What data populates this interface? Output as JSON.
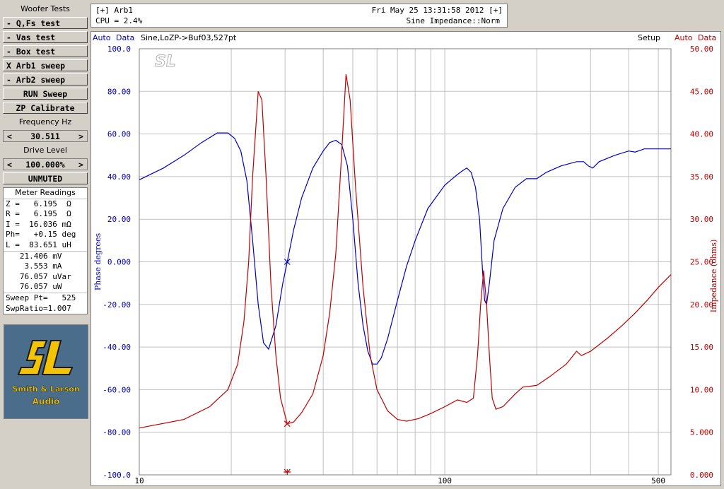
{
  "panel": {
    "title": "Woofer Tests",
    "buttons": {
      "qfs": "- Q,Fs test",
      "vas": "- Vas test",
      "box": "- Box test",
      "arb1": "X Arb1 sweep",
      "arb2": "- Arb2 sweep",
      "run": "RUN Sweep",
      "zp": "ZP Calibrate"
    },
    "freq_label": "Frequency Hz",
    "freq_value": "30.511",
    "drive_label": "Drive Level",
    "drive_value": "100.000%",
    "mute": "UNMUTED",
    "spin_left": "<",
    "spin_right": ">"
  },
  "meter": {
    "title": "Meter Readings",
    "lines": [
      "Z =   6.195  Ω",
      "R =   6.195  Ω",
      "I =  16.036 mΩ",
      "Ph=   +0.15 deg",
      "L =  83.651 uH",
      "   21.406 mV",
      "    3.553 mA",
      "   76.057 uVar",
      "   76.057 uW",
      "Sweep Pt=   525",
      "SwpRatio=1.007"
    ]
  },
  "logo": {
    "line1": "Smith & Larson",
    "line2": "Audio"
  },
  "header": {
    "window": "[+] Arb1",
    "datetime": "Fri May 25 13:31:58 2012 [+]",
    "cpu": "CPU = 2.4%",
    "mode": "Sine Impedance::Norm"
  },
  "graph": {
    "left_auto": "Auto",
    "left_data": "Data",
    "trace_info": "Sine,LoZP->Buf03,527pt",
    "setup": "Setup",
    "right_auto": "Auto",
    "right_data": "Data",
    "watermark": "SL"
  },
  "colors": {
    "phase": "#0000c0",
    "impedance": "#c00000",
    "grid": "#c0c0c0"
  },
  "chart_data": {
    "type": "line",
    "xscale": "log",
    "xlim": [
      10,
      550
    ],
    "x_ticks": [
      "10",
      "100",
      "500"
    ],
    "y_left": {
      "label": "Phase degrees",
      "range": [
        -100,
        100
      ],
      "ticks": [
        "100.0",
        "80.00",
        "60.00",
        "40.00",
        "20.00",
        "0.000",
        "-20.00",
        "-40.00",
        "-60.00",
        "-80.00",
        "-100.0"
      ]
    },
    "y_right": {
      "label": "Impedance (ohms)",
      "range": [
        0,
        50
      ],
      "ticks": [
        "50.00",
        "45.00",
        "40.00",
        "35.00",
        "30.00",
        "25.00",
        "20.00",
        "15.00",
        "10.00",
        "5.000",
        "0.000"
      ]
    },
    "cursor_x": 30.5,
    "series": [
      {
        "axis": "left",
        "color": "#0000c0",
        "points": [
          [
            10,
            38.5
          ],
          [
            12,
            44
          ],
          [
            14,
            50
          ],
          [
            16,
            56
          ],
          [
            18,
            60.5
          ],
          [
            19.5,
            60.5
          ],
          [
            20.5,
            58
          ],
          [
            21.5,
            52
          ],
          [
            22.5,
            38
          ],
          [
            23.5,
            10
          ],
          [
            24.5,
            -20
          ],
          [
            25.5,
            -38
          ],
          [
            26.5,
            -41
          ],
          [
            28,
            -30
          ],
          [
            29.5,
            -10
          ],
          [
            30.5,
            0
          ],
          [
            32,
            15
          ],
          [
            34,
            30
          ],
          [
            37,
            44
          ],
          [
            40,
            52
          ],
          [
            42,
            56
          ],
          [
            44,
            57
          ],
          [
            46,
            55
          ],
          [
            48,
            45
          ],
          [
            50,
            20
          ],
          [
            52,
            -10
          ],
          [
            54,
            -30
          ],
          [
            56,
            -42
          ],
          [
            58,
            -48
          ],
          [
            60,
            -48
          ],
          [
            62,
            -45
          ],
          [
            65,
            -36
          ],
          [
            70,
            -18
          ],
          [
            75,
            -2
          ],
          [
            80,
            10
          ],
          [
            88,
            25
          ],
          [
            100,
            36
          ],
          [
            110,
            41
          ],
          [
            115,
            43
          ],
          [
            118,
            44
          ],
          [
            122,
            42
          ],
          [
            126,
            35
          ],
          [
            130,
            20
          ],
          [
            133,
            -5
          ],
          [
            135,
            -18
          ],
          [
            137,
            -20
          ],
          [
            140,
            -10
          ],
          [
            145,
            10
          ],
          [
            155,
            25
          ],
          [
            170,
            35
          ],
          [
            185,
            39
          ],
          [
            200,
            39
          ],
          [
            215,
            42
          ],
          [
            240,
            45
          ],
          [
            270,
            47
          ],
          [
            285,
            47
          ],
          [
            295,
            45
          ],
          [
            305,
            44
          ],
          [
            320,
            47
          ],
          [
            360,
            50
          ],
          [
            400,
            52
          ],
          [
            420,
            51.5
          ],
          [
            450,
            53
          ],
          [
            550,
            53
          ],
          [
            560,
            52
          ],
          [
            575,
            49.5
          ],
          [
            600,
            51
          ],
          [
            640,
            52
          ]
        ]
      },
      {
        "axis": "right",
        "color": "#c00000",
        "points": [
          [
            10,
            5.5
          ],
          [
            14,
            6.5
          ],
          [
            17,
            8
          ],
          [
            19.5,
            10
          ],
          [
            21,
            13
          ],
          [
            22,
            18
          ],
          [
            22.8,
            25
          ],
          [
            23.5,
            35
          ],
          [
            24.5,
            45
          ],
          [
            25.2,
            44
          ],
          [
            26,
            35
          ],
          [
            27,
            22
          ],
          [
            28,
            14
          ],
          [
            29,
            9
          ],
          [
            30.5,
            6
          ],
          [
            32,
            6.2
          ],
          [
            34,
            7.3
          ],
          [
            37,
            9.5
          ],
          [
            40,
            14
          ],
          [
            42,
            19
          ],
          [
            44,
            26
          ],
          [
            46,
            38
          ],
          [
            47.5,
            47
          ],
          [
            49,
            44
          ],
          [
            51,
            34
          ],
          [
            54,
            22
          ],
          [
            57,
            14
          ],
          [
            60,
            10
          ],
          [
            65,
            7.5
          ],
          [
            70,
            6.5
          ],
          [
            75,
            6.3
          ],
          [
            82,
            6.6
          ],
          [
            90,
            7.2
          ],
          [
            100,
            8
          ],
          [
            110,
            8.8
          ],
          [
            118,
            8.5
          ],
          [
            124,
            9
          ],
          [
            128,
            14
          ],
          [
            131,
            20
          ],
          [
            134,
            24
          ],
          [
            137,
            20
          ],
          [
            140,
            14
          ],
          [
            143,
            9
          ],
          [
            147,
            7.7
          ],
          [
            155,
            8
          ],
          [
            170,
            9.5
          ],
          [
            180,
            10.3
          ],
          [
            200,
            10.5
          ],
          [
            220,
            11.5
          ],
          [
            250,
            13
          ],
          [
            270,
            14.5
          ],
          [
            280,
            14
          ],
          [
            300,
            14.5
          ],
          [
            340,
            16
          ],
          [
            380,
            17.5
          ],
          [
            420,
            19
          ],
          [
            460,
            20.5
          ],
          [
            500,
            22
          ],
          [
            550,
            23.5
          ],
          [
            590,
            25
          ],
          [
            620,
            26
          ],
          [
            650,
            26.5
          ],
          [
            665,
            25.5
          ],
          [
            700,
            26
          ],
          [
            740,
            27
          ],
          [
            790,
            28
          ],
          [
            820,
            28.5
          ]
        ]
      }
    ]
  }
}
